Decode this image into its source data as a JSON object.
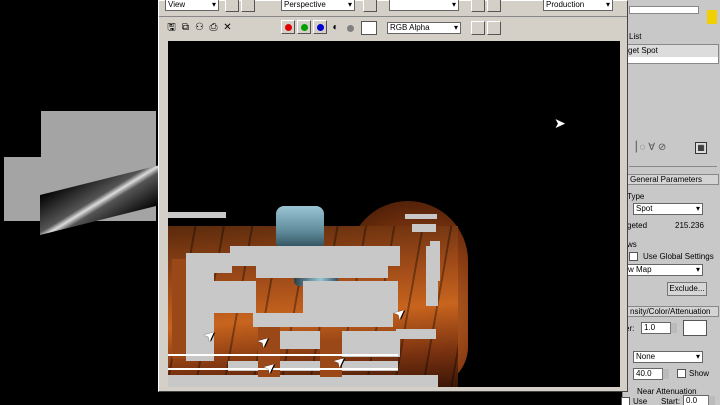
{
  "toolbar": {
    "area_dropdown_value": "View",
    "viewport_dropdown_value": "Perspective",
    "preset_dropdown_value": "",
    "renderer_dropdown_value": "Production",
    "channel_dropdown_value": "RGB Alpha",
    "colors": {
      "red": "#e00000",
      "green": "#00a000",
      "blue": "#0000d0",
      "mono": "#808080",
      "swatch": "#ffffff"
    }
  },
  "command_panel": {
    "name_list_label": "List",
    "object_name": "get Spot",
    "general_params_title": "General Parameters",
    "light_type_label": "Type",
    "light_type_value": "Spot",
    "targeted_label": "geted",
    "targeted_value": "215.236",
    "shadows_label": "ws",
    "use_global_label": "Use Global Settings",
    "shadow_type_value": "w Map",
    "exclude_label": "Exclude...",
    "intensity_title": "nsity/Color/Attenuation",
    "multiplier_label": "er:",
    "multiplier_value": "1.0",
    "decay_value": "None",
    "start_value": "40.0",
    "show_label": "Show",
    "near_atten_label": "Near Attenuation",
    "use_label": "Use",
    "near_start_label": "Start:",
    "near_start_value": "0.0"
  }
}
